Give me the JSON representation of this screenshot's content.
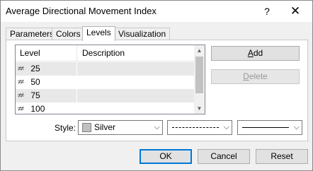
{
  "window": {
    "title": "Average Directional Movement Index",
    "help_glyph": "?",
    "close_glyph": "✕"
  },
  "tabs": [
    {
      "label": "Parameters",
      "active": false
    },
    {
      "label": "Colors",
      "active": false
    },
    {
      "label": "Levels",
      "active": true
    },
    {
      "label": "Visualization",
      "active": false
    }
  ],
  "levels_table": {
    "columns": [
      "Level",
      "Description"
    ],
    "rows": [
      {
        "level": "25",
        "description": ""
      },
      {
        "level": "50",
        "description": ""
      },
      {
        "level": "75",
        "description": ""
      },
      {
        "level": "100",
        "description": ""
      }
    ],
    "row_icon": "level-line-icon"
  },
  "buttons": {
    "add": {
      "hot": "A",
      "rest": "dd",
      "enabled": true
    },
    "delete": {
      "hot": "D",
      "rest": "elete",
      "enabled": false
    },
    "ok": "OK",
    "cancel": "Cancel",
    "reset": "Reset"
  },
  "style": {
    "label": "Style:",
    "color_value": "Silver",
    "color_hex": "#c0c0c0",
    "line_style": "dashed",
    "line_width": "solid-thin"
  }
}
